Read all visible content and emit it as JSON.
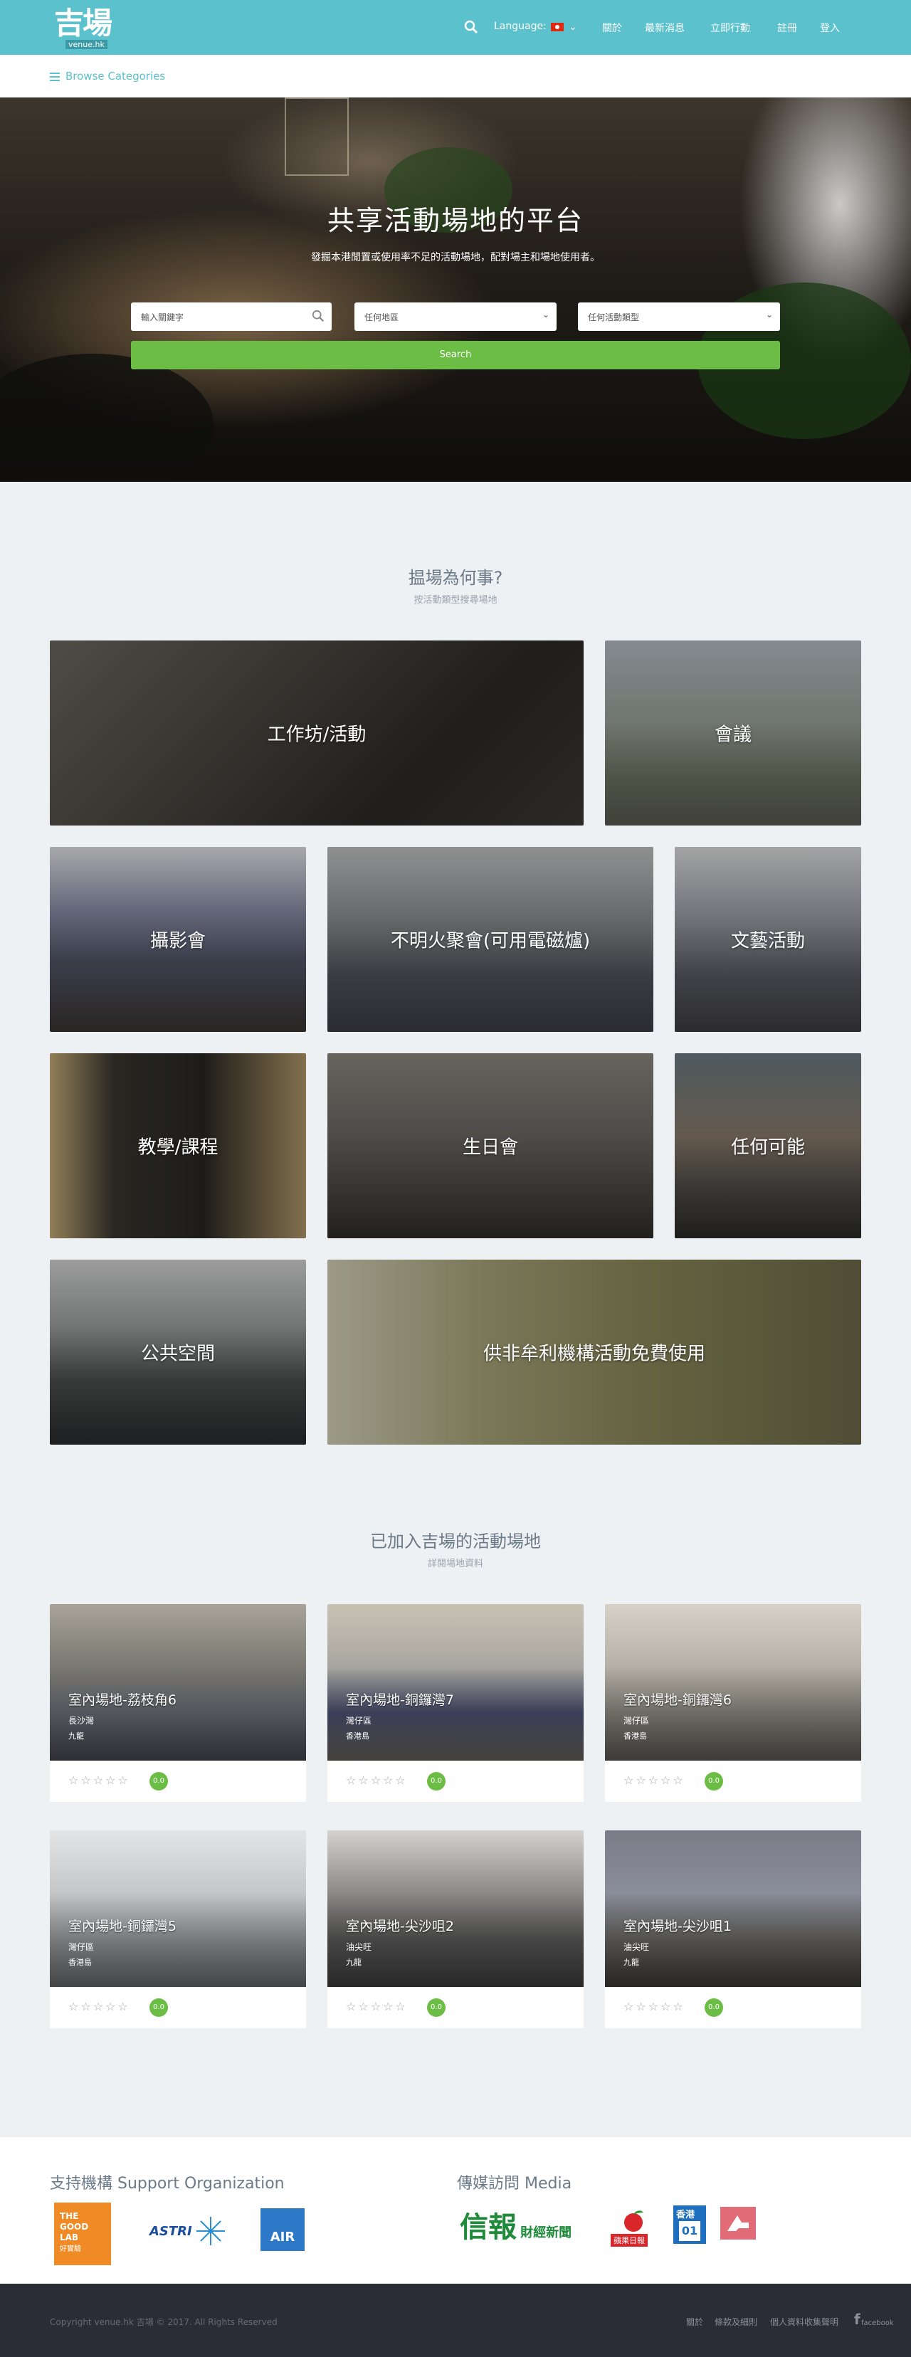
{
  "header": {
    "logo_text": "吉場",
    "logo_sub": "venue.hk",
    "language_label": "Language:",
    "nav": [
      "關於",
      "最新消息",
      "立即行動",
      "註冊",
      "登入"
    ]
  },
  "category_bar": {
    "label": "Browse Categories"
  },
  "hero": {
    "title": "共享活動場地的平台",
    "subtitle": "發掘本港閒置或使用率不足的活動場地，配對場主和場地使用者。",
    "keyword_placeholder": "輸入關鍵字",
    "region_select": "任何地區",
    "type_select": "任何活動類型",
    "search_label": "Search"
  },
  "why": {
    "title": "揾場為何事?",
    "subtitle": "按活動類型搜尋場地",
    "tiles": [
      "工作坊/活動",
      "會議",
      "攝影會",
      "不明火聚會(可用電磁爐)",
      "文藝活動",
      "教學/課程",
      "生日會",
      "任何可能",
      "公共空間",
      "供非牟利機構活動免費使用"
    ]
  },
  "venues": {
    "title": "已加入吉場的活動場地",
    "subtitle": "詳閱場地資料",
    "stars": "☆☆☆☆☆",
    "items": [
      {
        "name": "室內場地-荔枝角6",
        "district": "長沙灣",
        "region": "九龍",
        "score": "0.0"
      },
      {
        "name": "室內場地-銅鑼灣7",
        "district": "灣仔區",
        "region": "香港島",
        "score": "0.0"
      },
      {
        "name": "室內場地-銅鑼灣6",
        "district": "灣仔區",
        "region": "香港島",
        "score": "0.0"
      },
      {
        "name": "室內場地-銅鑼灣5",
        "district": "灣仔區",
        "region": "香港島",
        "score": "0.0"
      },
      {
        "name": "室內場地-尖沙咀2",
        "district": "油尖旺",
        "region": "九龍",
        "score": "0.0"
      },
      {
        "name": "室內場地-尖沙咀1",
        "district": "油尖旺",
        "region": "九龍",
        "score": "0.0"
      }
    ]
  },
  "support": {
    "title": "支持機構 Support Organization",
    "media_title": "傳媒訪問 Media",
    "logos": {
      "goodlab": "THE GOOD LAB",
      "goodlab_sub": "好實驗",
      "astri": "ASTRI",
      "air": "AIR",
      "hkej": "信報",
      "hkej_sub": "財經新聞",
      "apple": "蘋果日報",
      "rthk": "香港",
      "rthk_sub": "01"
    }
  },
  "footer": {
    "copyright": "Copyright venue.hk 吉場 © 2017. All Rights Reserved",
    "links": [
      "關於",
      "條款及細則",
      "個人資料收集聲明"
    ],
    "facebook": "facebook"
  }
}
